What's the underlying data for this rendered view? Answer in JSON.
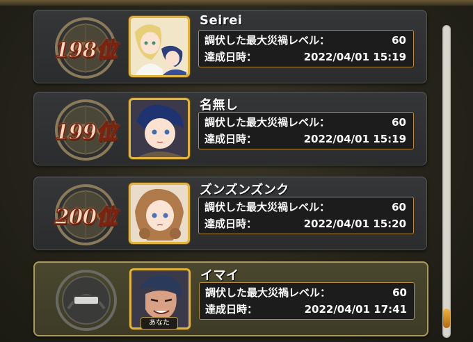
{
  "labels": {
    "max_level": "調伏した最大災禍レベル：",
    "achieved_at": "達成日時："
  },
  "rankings": [
    {
      "rank": "198位",
      "name": "Seirei",
      "level": "60",
      "datetime": "2022/04/01 15:19",
      "is_self": false
    },
    {
      "rank": "199位",
      "name": "名無し",
      "level": "60",
      "datetime": "2022/04/01 15:19",
      "is_self": false
    },
    {
      "rank": "200位",
      "name": "ズンズンズンク",
      "level": "60",
      "datetime": "2022/04/01 15:20",
      "is_self": false
    },
    {
      "rank": "",
      "name": "イマイ",
      "level": "60",
      "datetime": "2022/04/01 17:41",
      "is_self": true,
      "self_label": "あなた"
    }
  ],
  "scrollbar": {
    "position": 0.97
  },
  "colors": {
    "gold_border": "#e3b43c",
    "rank_red": "#7a2410",
    "self_highlight": "#a89a5a"
  }
}
